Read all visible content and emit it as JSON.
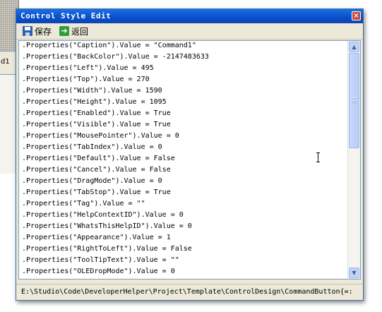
{
  "background": {
    "tab_label": "d1"
  },
  "window": {
    "title": "Control Style Edit",
    "close_symbol": "×"
  },
  "toolbar": {
    "save_label": "保存",
    "back_label": "返回",
    "save_icon": "save-icon",
    "back_icon": "back-arrow-icon"
  },
  "editor": {
    "lines": [
      ".Properties(\"Caption\").Value = \"Command1\"",
      ".Properties(\"BackColor\").Value = -2147483633",
      ".Properties(\"Left\").Value = 495",
      ".Properties(\"Top\").Value = 270",
      ".Properties(\"Width\").Value = 1590",
      ".Properties(\"Height\").Value = 1095",
      ".Properties(\"Enabled\").Value = True",
      ".Properties(\"Visible\").Value = True",
      ".Properties(\"MousePointer\").Value = 0",
      ".Properties(\"TabIndex\").Value = 0",
      ".Properties(\"Default\").Value = False",
      ".Properties(\"Cancel\").Value = False",
      ".Properties(\"DragMode\").Value = 0",
      ".Properties(\"TabStop\").Value = True",
      ".Properties(\"Tag\").Value = \"\"",
      ".Properties(\"HelpContextID\").Value = 0",
      ".Properties(\"WhatsThisHelpID\").Value = 0",
      ".Properties(\"Appearance\").Value = 1",
      ".Properties(\"RightToLeft\").Value = False",
      ".Properties(\"ToolTipText\").Value = \"\"",
      ".Properties(\"OLEDropMode\").Value = 0"
    ],
    "scroll_up_symbol": "▲",
    "scroll_down_symbol": "▼"
  },
  "status": {
    "path": "E:\\Studio\\Code\\DeveloperHelper\\Project\\Template\\ControlDesign\\CommandButton{=:"
  },
  "colors": {
    "titlebar": "#0a4fc8",
    "window_face": "#ece9d8",
    "editor_bg": "#ffffff"
  }
}
